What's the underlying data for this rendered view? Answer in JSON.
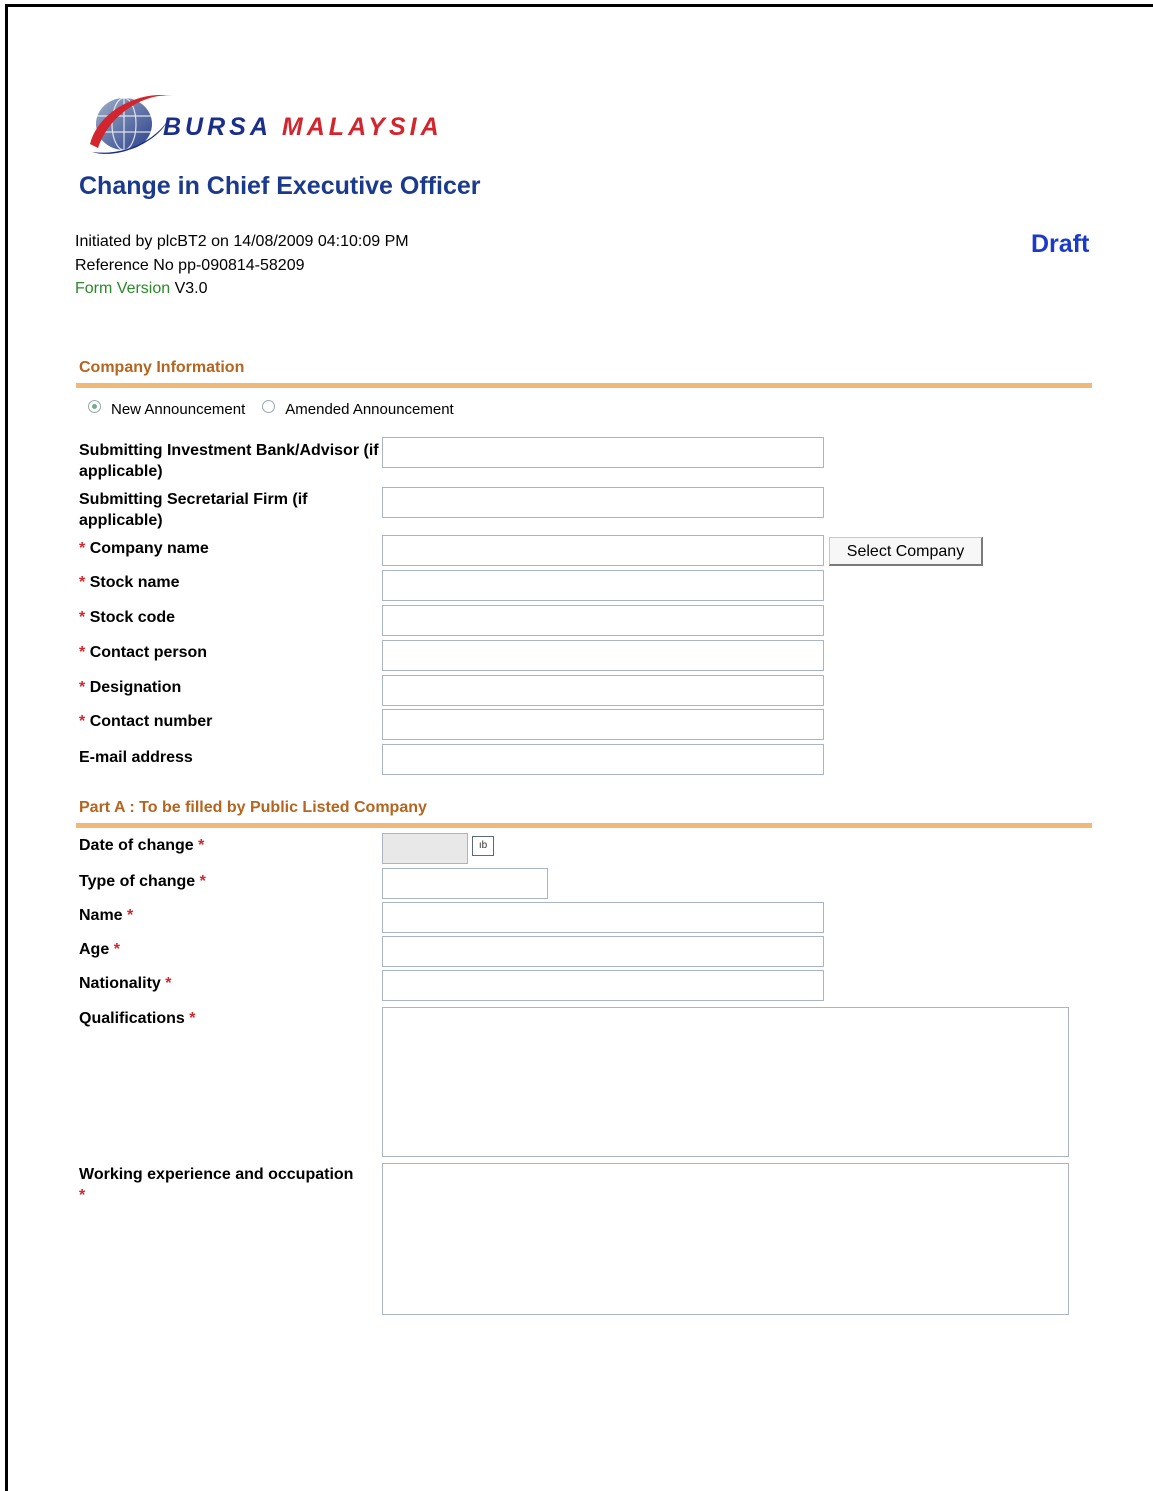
{
  "brand": {
    "name_part1": "BURSA",
    "name_part2": "MALAYSIA"
  },
  "header": {
    "title": "Change in Chief Executive Officer",
    "initiated_line": "Initiated by plcBT2 on 14/08/2009 04:10:09 PM",
    "reference_line": "Reference No pp-090814-58209",
    "form_version_label": "Form Version",
    "form_version_value": "V3.0",
    "status": "Draft"
  },
  "company_info": {
    "section_title": "Company Information",
    "announcement_options": [
      {
        "label": "New Announcement",
        "selected": true
      },
      {
        "label": "Amended Announcement",
        "selected": false
      }
    ],
    "fields": {
      "investment_bank": {
        "label": "Submitting Investment Bank/Advisor (if applicable)",
        "value": ""
      },
      "secretarial_firm": {
        "label": "Submitting Secretarial Firm (if applicable)",
        "value": ""
      },
      "company_name": {
        "label": "Company name",
        "value": ""
      },
      "stock_name": {
        "label": "Stock name",
        "value": ""
      },
      "stock_code": {
        "label": "Stock code",
        "value": ""
      },
      "contact_person": {
        "label": "Contact person",
        "value": ""
      },
      "designation": {
        "label": "Designation",
        "value": ""
      },
      "contact_number": {
        "label": "Contact number",
        "value": ""
      },
      "email": {
        "label": "E-mail address",
        "value": ""
      }
    },
    "select_company_button": "Select Company",
    "required_mark": "*"
  },
  "part_a": {
    "section_title": "Part A : To be filled by Public Listed Company",
    "fields": {
      "date_of_change": {
        "label": "Date of change",
        "value": ""
      },
      "type_of_change": {
        "label": "Type of change",
        "value": ""
      },
      "name": {
        "label": "Name",
        "value": ""
      },
      "age": {
        "label": "Age",
        "value": ""
      },
      "nationality": {
        "label": "Nationality",
        "value": ""
      },
      "qualifications": {
        "label": "Qualifications",
        "value": ""
      },
      "working_experience": {
        "label": "Working experience and occupation",
        "value": ""
      }
    },
    "calendar_icon_text": "ıb",
    "required_mark": "*"
  },
  "colors": {
    "title_blue": "#1b3a8c",
    "status_blue": "#1b3ac8",
    "section_orange": "#b5651d",
    "rule_orange": "#f1b979",
    "required_red": "#d3252d",
    "form_version_green": "#2a8a2a"
  },
  "icons": {
    "logo": "bursa-globe-logo",
    "calendar": "calendar-icon",
    "radio": "radio-button"
  }
}
